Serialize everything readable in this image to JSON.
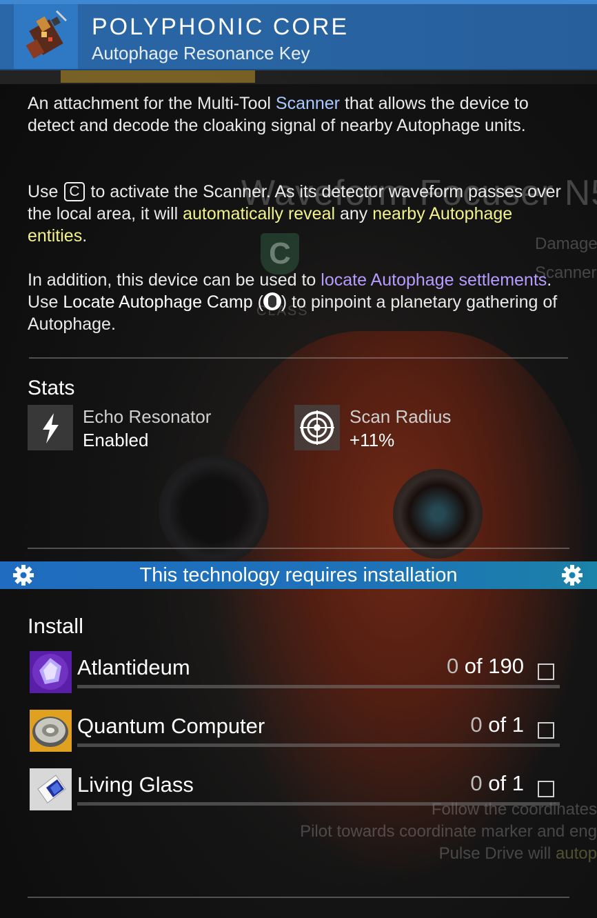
{
  "header": {
    "title": "POLYPHONIC CORE",
    "subtitle": "Autophage Resonance Key",
    "icon": "polyphonic-core-icon"
  },
  "description": {
    "p1_a": "An attachment for the Multi-Tool ",
    "p1_scanner": "Scanner",
    "p1_b": " that allows the device to detect and decode the cloaking signal of nearby Autophage units.",
    "p2_a": "Use ",
    "p2_key": "C",
    "p2_b": " to activate the Scanner. As its detector waveform passes over the local area, it will ",
    "p2_hl1": "automatically reveal",
    "p2_c": " any ",
    "p2_hl2": "nearby Autophage entities",
    "p2_d": ".",
    "p3_a": "In addition, this device can be used to ",
    "p3_hl": "locate Autophage settlements",
    "p3_b": ". Use ",
    "p3_action": "Locate Autophage Camp",
    "p3_c": " (",
    "p3_d": ") to pinpoint a planetary gathering of Autophage."
  },
  "background_text": {
    "item_name": "Waveform Focuser N5",
    "side1": "Damage",
    "side2": "Scanner",
    "class_letter": "C",
    "class_label": "CLASS",
    "follow1": "Follow the coordinates",
    "follow2": "Pilot towards coordinate marker and eng",
    "follow3_a": "Pulse Drive will ",
    "follow3_b": "autop"
  },
  "stats": {
    "title": "Stats",
    "items": [
      {
        "label": "Echo Resonator",
        "value": "Enabled",
        "icon": "lightning-icon"
      },
      {
        "label": "Scan Radius",
        "value": "+11%",
        "icon": "target-icon"
      }
    ]
  },
  "install_banner": {
    "text": "This technology requires installation"
  },
  "install": {
    "title": "Install",
    "items": [
      {
        "name": "Atlantideum",
        "have": "0",
        "of": " of 190",
        "icon": "atlantideum-icon"
      },
      {
        "name": "Quantum Computer",
        "have": "0",
        "of": " of 1",
        "icon": "quantum-computer-icon"
      },
      {
        "name": "Living Glass",
        "have": "0",
        "of": " of 1",
        "icon": "living-glass-icon"
      }
    ]
  },
  "colors": {
    "header_bg": "#2a67a8",
    "banner_bg": "#1f6cc0",
    "keyword_blue": "#a9c9ff",
    "keyword_yellow": "#f4f28a",
    "keyword_purple": "#b79cff"
  }
}
